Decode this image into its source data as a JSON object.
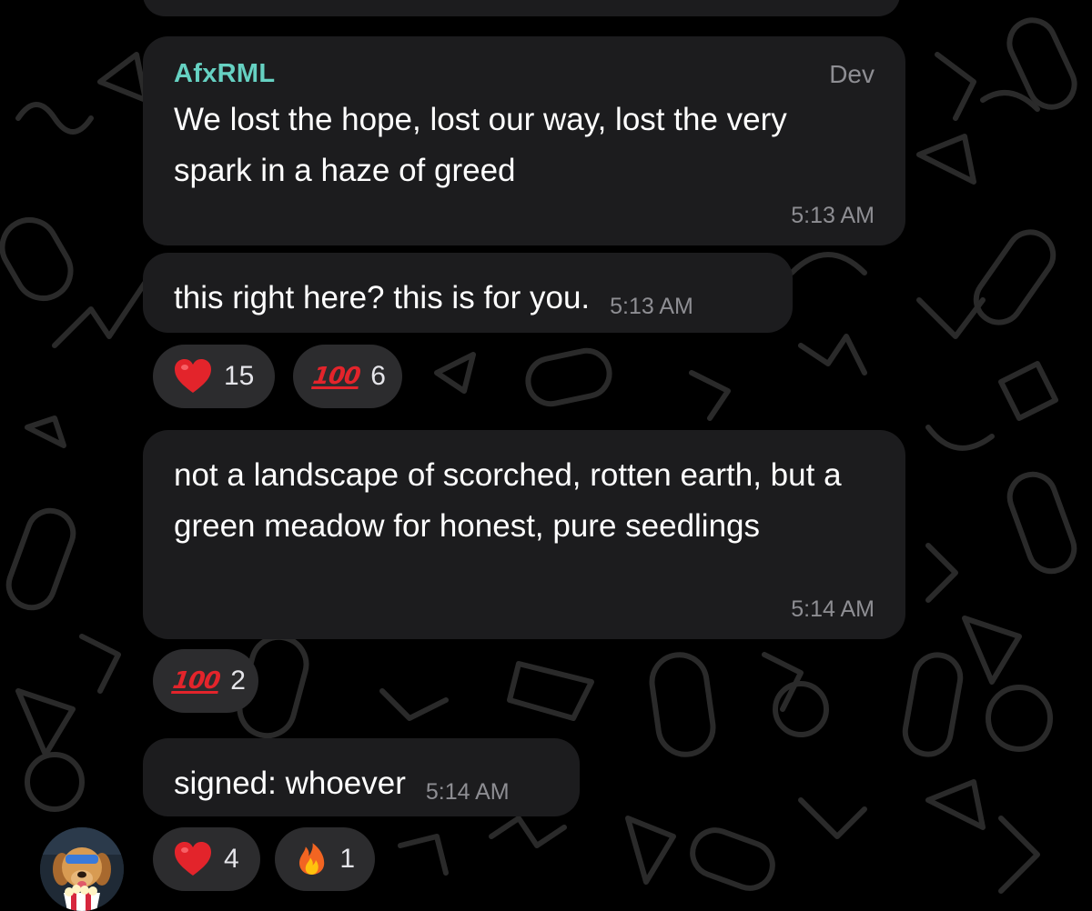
{
  "messages": [
    {
      "sender": "AfxRML",
      "admin_title": "Dev",
      "text": "We lost the hope, lost our way, lost the very spark in a haze of greed",
      "time": "5:13 AM"
    },
    {
      "text": "this right here? this is for you.",
      "time": "5:13 AM",
      "reactions": [
        {
          "emoji": "heart",
          "count": "15"
        },
        {
          "emoji": "hundred",
          "glyph": "100",
          "count": "6"
        }
      ]
    },
    {
      "text": "not a landscape of scorched, rotten earth, but a green meadow for honest, pure seedlings",
      "time": "5:14 AM",
      "reactions": [
        {
          "emoji": "hundred",
          "glyph": "100",
          "count": "2"
        }
      ]
    },
    {
      "text": "signed: whoever",
      "time": "5:14 AM",
      "reactions": [
        {
          "emoji": "heart",
          "count": "4"
        },
        {
          "emoji": "fire",
          "count": "1"
        }
      ]
    }
  ],
  "avatar": {
    "icon": "dog-with-popcorn-avatar"
  },
  "colors": {
    "background": "#000000",
    "bubble": "#1c1c1e",
    "reaction_bg": "#2c2c2e",
    "sender_name": "#66d1c2",
    "timestamp": "#8e8e93",
    "heart": "#e3242b",
    "hundred": "#e3242b"
  }
}
